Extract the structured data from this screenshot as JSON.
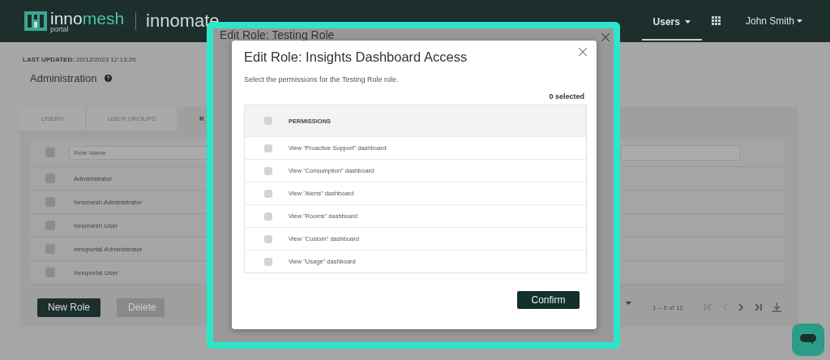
{
  "header": {
    "brand": {
      "prefix": "inno",
      "suffix": "mesh",
      "sub": "portal"
    },
    "product": "innomate",
    "nav": [
      {
        "label": "Users",
        "selected": true
      }
    ],
    "user": "John Smith"
  },
  "page": {
    "last_updated_label": "LAST UPDATED:",
    "last_updated": "20/12/2023 12:13:20",
    "title": "Administration"
  },
  "tabs": [
    {
      "label": "USERS",
      "selected": false
    },
    {
      "label": "USER GROUPS",
      "selected": false
    },
    {
      "label": "R",
      "selected": true
    }
  ],
  "roles_table": {
    "filter_placeholder": "Role Name",
    "all_checked": false,
    "rows": [
      {
        "name": "Administrator",
        "checked": false
      },
      {
        "name": "Innomesh Administrator",
        "checked": false
      },
      {
        "name": "Innomesh User",
        "checked": false
      },
      {
        "name": "Innoportal Administrator",
        "checked": false
      },
      {
        "name": "Innoportal User",
        "checked": false
      }
    ]
  },
  "actions": [
    {
      "label": "New Role",
      "disabled": false
    },
    {
      "label": "Delete",
      "disabled": true
    }
  ],
  "pager": {
    "range": "1 – 5 of 12"
  },
  "background_dialog": {
    "title": "Edit Role: Testing Role"
  },
  "dialog": {
    "title": "Edit Role: Insights Dashboard Access",
    "description": "Select the permissions for the Testing Role role.",
    "selected_count": "0 selected",
    "column": "PERMISSIONS",
    "all_checked": false,
    "permissions": [
      {
        "label": "View \"Proactive Support\" dashboard",
        "checked": false
      },
      {
        "label": "View \"Consumption\" dashboard",
        "checked": false
      },
      {
        "label": "View \"Alerts\" dashboard",
        "checked": false
      },
      {
        "label": "View \"Rooms\" dashboard",
        "checked": false
      },
      {
        "label": "View \"Custom\" dashboard",
        "checked": false
      },
      {
        "label": "View \"Usage\" dashboard",
        "checked": false
      }
    ],
    "confirm": "Confirm"
  }
}
